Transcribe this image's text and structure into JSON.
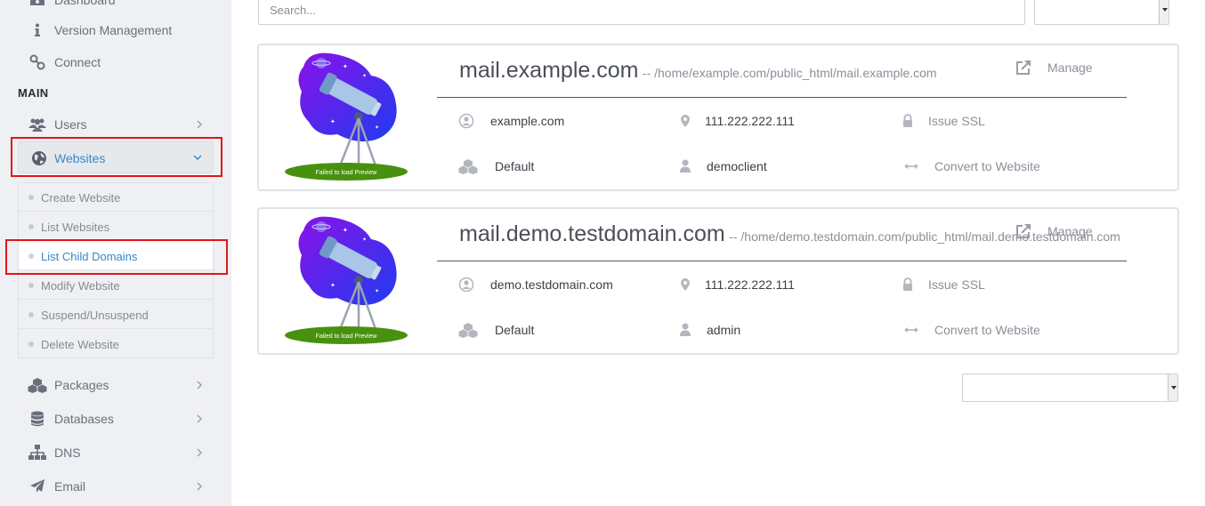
{
  "sidebar": {
    "top_items": [
      {
        "label": "Dashboard",
        "icon": "dashboard-icon"
      },
      {
        "label": "Version Management",
        "icon": "info-icon"
      },
      {
        "label": "Connect",
        "icon": "link-icon"
      }
    ],
    "section_label": "MAIN",
    "users": {
      "label": "Users",
      "icon": "users-icon"
    },
    "websites": {
      "label": "Websites",
      "icon": "globe-icon"
    },
    "websites_submenu": [
      {
        "label": "Create Website"
      },
      {
        "label": "List Websites"
      },
      {
        "label": "List Child Domains",
        "active": true
      },
      {
        "label": "Modify Website"
      },
      {
        "label": "Suspend/Unsuspend"
      },
      {
        "label": "Delete Website"
      }
    ],
    "bottom_items": [
      {
        "label": "Packages",
        "icon": "cubes-icon"
      },
      {
        "label": "Databases",
        "icon": "database-icon"
      },
      {
        "label": "DNS",
        "icon": "sitemap-icon"
      },
      {
        "label": "Email",
        "icon": "paper-plane-icon"
      }
    ]
  },
  "search": {
    "placeholder": "Search..."
  },
  "child_domains": [
    {
      "domain": "mail.example.com",
      "path": "-- /home/example.com/public_html/mail.example.com",
      "manage_label": "Manage",
      "master_domain": "example.com",
      "ip": "111.222.222.111",
      "ssl_label": "Issue SSL",
      "package": "Default",
      "owner": "democlient",
      "convert_label": "Convert to Website",
      "preview_caption": "Failed to load Preview"
    },
    {
      "domain": "mail.demo.testdomain.com",
      "path": "-- /home/demo.testdomain.com/public_html/mail.demo.testdomain.com",
      "manage_label": "Manage",
      "master_domain": "demo.testdomain.com",
      "ip": "111.222.222.111",
      "ssl_label": "Issue SSL",
      "package": "Default",
      "owner": "admin",
      "convert_label": "Convert to Website",
      "preview_caption": "Failed to load Preview"
    }
  ],
  "colors": {
    "accent": "#3a86c8",
    "highlight_box": "#e0161a",
    "sidebar_bg": "#eff0f3"
  }
}
